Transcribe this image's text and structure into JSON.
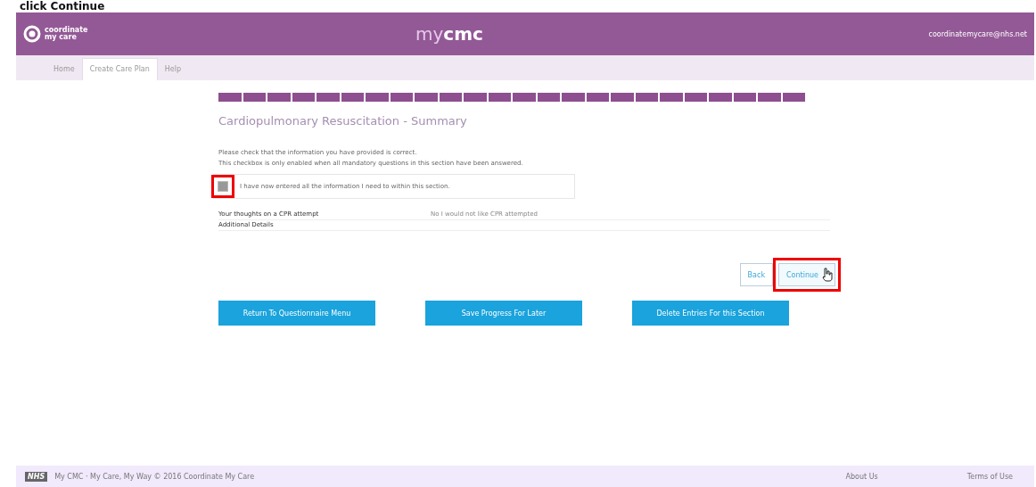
{
  "caption": "click Continue",
  "header": {
    "logo_text": [
      "coordinate",
      "my care"
    ],
    "brand_light": "my",
    "brand_bold": "cmc",
    "user_email": "coordinatemycare@nhs.net"
  },
  "tabs": [
    {
      "label": "Home",
      "selected": false
    },
    {
      "label": "Create Care Plan",
      "selected": true
    },
    {
      "label": "Help",
      "selected": false
    }
  ],
  "progress": {
    "segments": [
      {
        "done": true
      },
      {
        "done": true
      },
      {
        "done": true
      },
      {
        "done": true
      },
      {
        "done": true
      },
      {
        "done": true
      },
      {
        "done": true
      },
      {
        "done": true
      },
      {
        "done": true
      },
      {
        "done": true
      },
      {
        "done": true
      },
      {
        "done": true
      },
      {
        "done": true
      },
      {
        "done": true
      },
      {
        "done": true
      },
      {
        "done": true
      },
      {
        "done": true
      },
      {
        "done": true
      },
      {
        "done": true
      },
      {
        "done": true
      },
      {
        "done": true
      },
      {
        "done": true
      },
      {
        "done": true
      },
      {
        "done": true
      }
    ]
  },
  "title": "Cardiopulmonary Resuscitation - Summary",
  "instructions": [
    "Please check that the information you have provided is correct.",
    "This checkbox is only enabled when all mandatory questions in this section have been answered."
  ],
  "confirm": {
    "label": "I have now entered all the information I need to within this section.",
    "checked": false,
    "disabled": true,
    "highlighted": true
  },
  "summary_rows": [
    {
      "question": "Your thoughts on a CPR attempt",
      "answer": "No I would not like CPR attempted"
    },
    {
      "question": "Additional Details",
      "answer": ""
    }
  ],
  "nav_buttons": [
    {
      "label": "Back",
      "highlighted": false,
      "hovered": false
    },
    {
      "label": "Continue",
      "highlighted": true,
      "hovered": true
    }
  ],
  "action_buttons": [
    "Return To Questionnaire Menu",
    "Save Progress For Later",
    "Delete Entries For this Section"
  ],
  "footer": {
    "badge": "NHS",
    "text": "My CMC · My Care, My Way © 2016 Coordinate My Care",
    "links": [
      "About Us",
      "Terms of Use"
    ]
  }
}
